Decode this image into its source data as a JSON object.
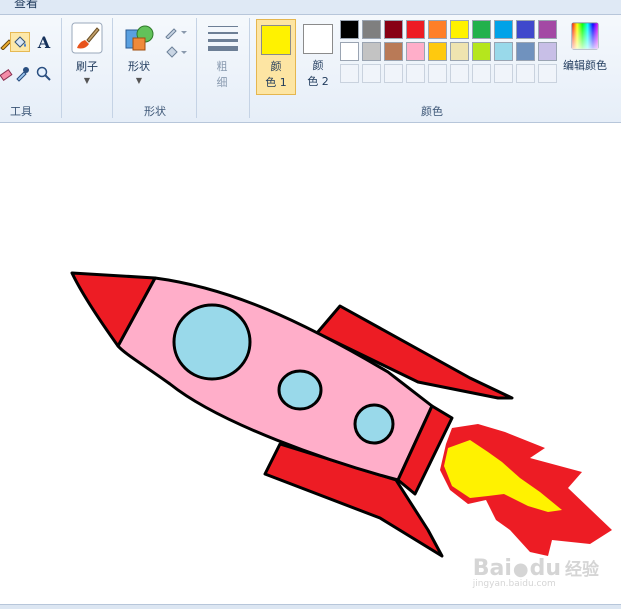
{
  "ribbon": {
    "tab_view": "查看",
    "groups": {
      "tools": "工具",
      "shapes": "形状",
      "colors": "颜色"
    },
    "brush_label": "刷子",
    "shapes_label": "形状",
    "size_label_line1": "粗",
    "size_label_line2": "细",
    "color1_line1": "颜",
    "color1_line2": "色 1",
    "color2_line1": "颜",
    "color2_line2": "色 2",
    "edit_colors_label": "编辑颜色",
    "text_tool_glyph": "A",
    "color1_value": "#fff200",
    "color2_value": "#ffffff"
  },
  "palette": [
    "#000000",
    "#7f7f7f",
    "#880015",
    "#ed1c24",
    "#ff7f27",
    "#fff200",
    "#22b14c",
    "#00a2e8",
    "#3f48cc",
    "#a349a4",
    "#ffffff",
    "#c3c3c3",
    "#b97a57",
    "#ffaec9",
    "#ffc90e",
    "#efe4b0",
    "#b5e61d",
    "#99d9ea",
    "#7092be",
    "#c8bfe7",
    "",
    "",
    "",
    "",
    "",
    "",
    "",
    "",
    "",
    ""
  ],
  "drawing": {
    "subject": "rocket",
    "colors": {
      "body": "#ffaec9",
      "fins": "#ed1c24",
      "windows": "#99d9ea",
      "flame": "#fff200",
      "outline": "#000000"
    }
  },
  "watermark": {
    "brand": "Bai",
    "brand2": "百",
    "brand3": "du",
    "sub": "经验",
    "url": "jingyan.baidu.com"
  }
}
